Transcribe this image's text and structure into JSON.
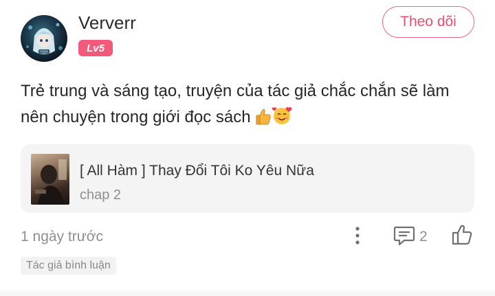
{
  "user": {
    "name": "Ververr",
    "level": "Lv5",
    "avatar_icon": "anime-girl-avatar"
  },
  "follow_button": {
    "label": "Theo dõi"
  },
  "comment": {
    "text": "Trẻ trung và sáng tạo, truyện của tác giả chắc chắn sẽ làm nên chuyện trong giới đọc sách",
    "emojis": [
      "thumbs-up-emoji",
      "smiling-face-with-hearts-emoji"
    ]
  },
  "story_card": {
    "title": "[ All Hàm ] Thay Đổi Tôi Ko Yêu Nữa",
    "chapter": "chap 2"
  },
  "footer": {
    "time": "1 ngày trước",
    "reply_count": "2",
    "tag": "Tác giả bình luận"
  },
  "colors": {
    "accent": "#ee4d6d",
    "badge": "#f25a7b",
    "muted_text": "#8f8f94",
    "card_bg": "#f4f4f5"
  }
}
